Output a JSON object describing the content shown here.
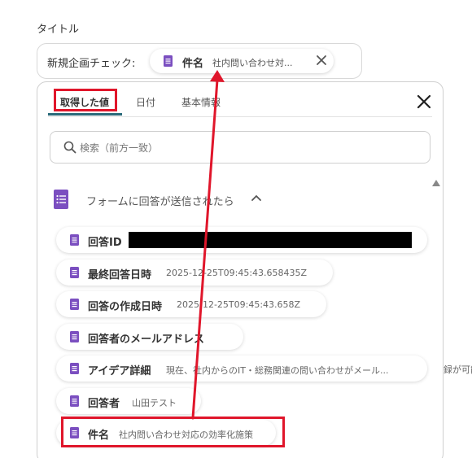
{
  "title_label": "タイトル",
  "field": {
    "prefix": "新規企画チェック:",
    "chip": {
      "name": "件名",
      "value": "社内問い合わせ対..."
    }
  },
  "tabs": [
    {
      "label": "取得した値",
      "active": true
    },
    {
      "label": "日付",
      "active": false
    },
    {
      "label": "基本情報",
      "active": false
    }
  ],
  "search": {
    "placeholder": "検索（前方一致）",
    "value": ""
  },
  "group": {
    "title": "フォームに回答が送信されたら"
  },
  "items": [
    {
      "name": "回答ID",
      "value": ""
    },
    {
      "name": "最終回答日時",
      "value": "2025-12-25T09:45:43.658435Z"
    },
    {
      "name": "回答の作成日時",
      "value": "2025-12-25T09:45:43.658Z"
    },
    {
      "name": "回答者のメールアドレス",
      "value": ""
    },
    {
      "name": "アイデア詳細",
      "value": "現在、社内からのIT・総務関連の問い合わせがメール..."
    },
    {
      "name": "回答者",
      "value": "山田テスト"
    },
    {
      "name": "件名",
      "value": "社内問い合わせ対応の効率化施策"
    }
  ],
  "overflow_text": "録が可能",
  "colors": {
    "highlight": "#e0162b",
    "form_icon": "#7b4fc0",
    "tab_underline": "#2a6a7a"
  },
  "icons": {
    "form": "form-doc-icon",
    "search": "search-icon",
    "close": "close-icon",
    "chevron": "chevron-up-icon"
  }
}
